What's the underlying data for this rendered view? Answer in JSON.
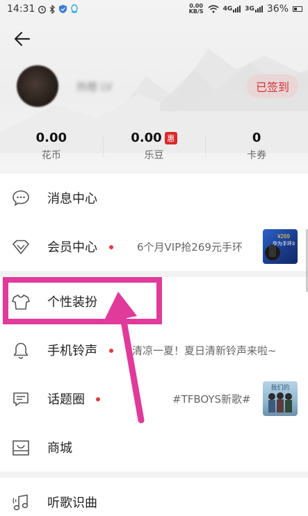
{
  "status_bar": {
    "time": "14:31",
    "net_speed_top": "0.00",
    "net_speed_bottom": "KB/S",
    "signal1_label": "4G",
    "signal2_label": "3G",
    "battery": "36%"
  },
  "profile": {
    "username": "热橙 LV",
    "signed_label": "已签到"
  },
  "stats": [
    {
      "value": "0.00",
      "label": "花币"
    },
    {
      "value": "0.00",
      "label": "乐豆",
      "badge": "惠"
    },
    {
      "value": "0",
      "label": "卡券"
    }
  ],
  "menu": {
    "messages": {
      "label": "消息中心"
    },
    "vip": {
      "label": "会员中心",
      "desc": "6个月VIP抢269元手环",
      "thumb_text": "¥269\n华为手环3"
    },
    "skin": {
      "label": "个性装扮"
    },
    "ringtone": {
      "label": "手机铃声",
      "desc": "清凉一夏！夏日清新铃声来啦~"
    },
    "topics": {
      "label": "话题圈",
      "desc": "#TFBOYS新歌#",
      "thumb_text": "我们的"
    },
    "store": {
      "label": "商城"
    },
    "recognize": {
      "label": "听歌识曲"
    }
  },
  "colors": {
    "accent_red": "#e23b3b",
    "highlight_pink": "#e03a9a"
  }
}
